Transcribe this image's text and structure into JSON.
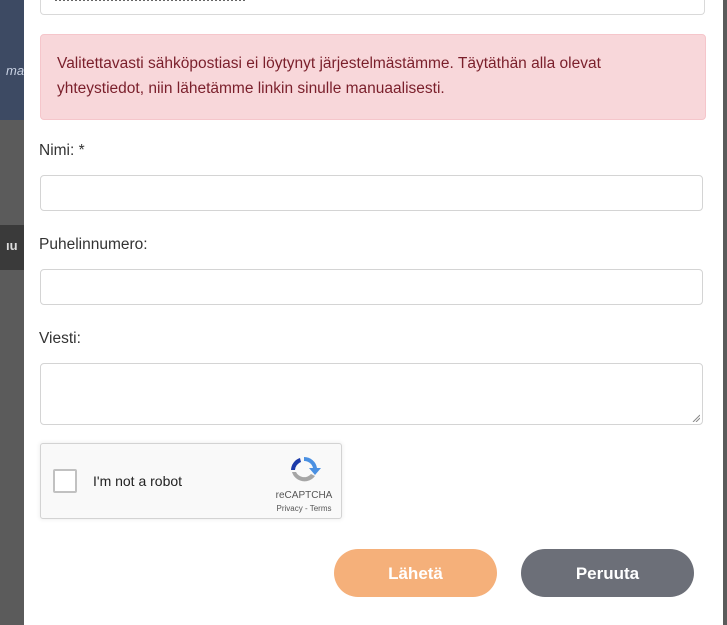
{
  "backdrop": {
    "fragment_top": "ma",
    "fragment_mid": "ıu"
  },
  "alert": {
    "text": "Valitettavasti sähköpostiasi ei löytynyt järjestelmästämme. Täytäthän alla olevat yhteystiedot, niin lähetämme linkin sinulle manuaalisesti.",
    "background_color": "#f8d7da",
    "text_color": "#7a1f2b"
  },
  "form": {
    "name_label": "Nimi: *",
    "name_value": "",
    "phone_label": "Puhelinnumero:",
    "phone_value": "",
    "message_label": "Viesti:",
    "message_value": ""
  },
  "recaptcha": {
    "label": "I'm not a robot",
    "brand": "reCAPTCHA",
    "links": "Privacy - Terms",
    "checked": false
  },
  "buttons": {
    "send_label": "Lähetä",
    "cancel_label": "Peruuta",
    "send_color": "#f5b07a",
    "cancel_color": "#6c6f78"
  }
}
